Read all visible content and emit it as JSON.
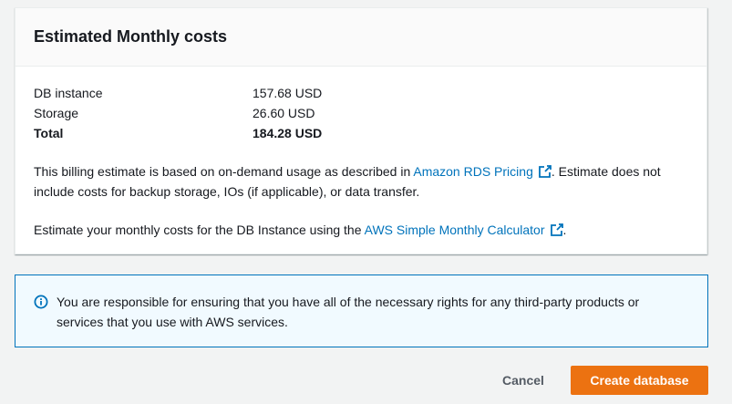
{
  "colors": {
    "page_bg": "#f2f3f3",
    "link": "#0073bb",
    "primary_button": "#ec7211",
    "info_bg": "#f1faff",
    "info_border": "#0073bb"
  },
  "costs_panel": {
    "title": "Estimated Monthly costs",
    "rows": [
      {
        "label": "DB instance",
        "value": "157.68 USD"
      },
      {
        "label": "Storage",
        "value": "26.60 USD"
      },
      {
        "label": "Total",
        "value": "184.28 USD"
      }
    ],
    "para1": {
      "before": "This billing estimate is based on on-demand usage as described in ",
      "link": "Amazon RDS Pricing",
      "after": ". Estimate does not include costs for backup storage, IOs (if applicable), or data transfer."
    },
    "para2": {
      "before": "Estimate your monthly costs for the DB Instance using the ",
      "link": "AWS Simple Monthly Calculator",
      "after": "."
    },
    "link_icon": "external-link-icon"
  },
  "info_alert": {
    "icon": "info-icon",
    "text": "You are responsible for ensuring that you have all of the necessary rights for any third-party products or services that you use with AWS services."
  },
  "footer": {
    "cancel_label": "Cancel",
    "create_label": "Create database"
  }
}
